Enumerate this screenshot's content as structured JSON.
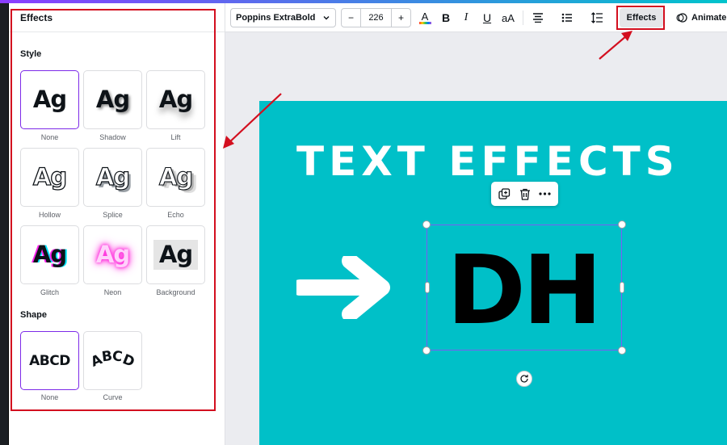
{
  "panel": {
    "title": "Effects",
    "style_heading": "Style",
    "shape_heading": "Shape",
    "sample_text": "Ag",
    "styles": [
      {
        "label": "None",
        "selected": true
      },
      {
        "label": "Shadow",
        "selected": false
      },
      {
        "label": "Lift",
        "selected": false
      },
      {
        "label": "Hollow",
        "selected": false
      },
      {
        "label": "Splice",
        "selected": false
      },
      {
        "label": "Echo",
        "selected": false
      },
      {
        "label": "Glitch",
        "selected": false
      },
      {
        "label": "Neon",
        "selected": false
      },
      {
        "label": "Background",
        "selected": false
      }
    ],
    "shape_sample": "ABCD",
    "shapes": [
      {
        "label": "None",
        "selected": true
      },
      {
        "label": "Curve",
        "selected": false
      }
    ]
  },
  "toolbar": {
    "font_name": "Poppins ExtraBold",
    "font_size": "226",
    "minus_label": "−",
    "plus_label": "+",
    "bold_label": "B",
    "italic_label": "I",
    "underline_label": "U",
    "case_label": "aA",
    "effects_label": "Effects",
    "animate_label": "Animate"
  },
  "canvas": {
    "headline": "TEXT EFFECTS",
    "selected_text": "DH",
    "background_color": "#00c0c8"
  },
  "colors": {
    "accent_purple": "#7d2ae8",
    "annotation_red": "#d30f1f"
  }
}
